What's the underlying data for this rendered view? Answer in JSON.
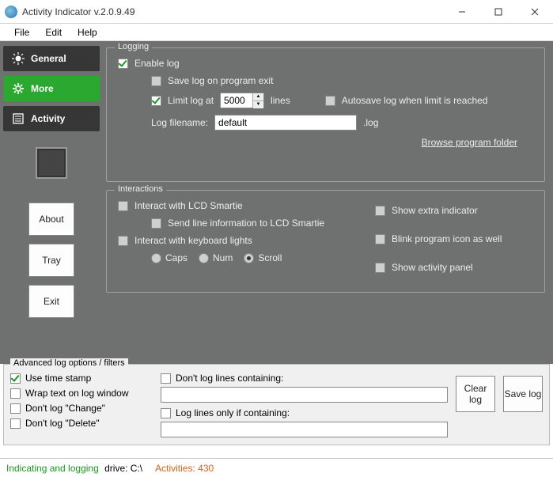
{
  "window": {
    "title": "Activity Indicator v.2.0.9.49"
  },
  "menu": {
    "file": "File",
    "edit": "Edit",
    "help": "Help"
  },
  "nav": {
    "general": "General",
    "more": "More",
    "activity": "Activity"
  },
  "sidebuttons": {
    "about": "About",
    "tray": "Tray",
    "exit": "Exit"
  },
  "logging": {
    "legend": "Logging",
    "enable": "Enable log",
    "save_on_exit": "Save log on program exit",
    "limit_at": "Limit log at",
    "limit_value": "5000",
    "lines": "lines",
    "autosave": "Autosave log when limit is reached",
    "filename_label": "Log filename:",
    "filename_value": "default",
    "ext": ".log",
    "browse": "Browse program folder"
  },
  "interactions": {
    "legend": "Interactions",
    "lcd": "Interact with LCD Smartie",
    "send_line": "Send line information to LCD Smartie",
    "kbd": "Interact with keyboard lights",
    "caps": "Caps",
    "num": "Num",
    "scroll": "Scroll",
    "extra": "Show extra indicator",
    "blink": "Blink program icon as well",
    "panel": "Show activity panel"
  },
  "advanced": {
    "legend": "Advanced log options / filters",
    "timestamp": "Use time stamp",
    "wrap": "Wrap text on log window",
    "no_change": "Don't log \"Change\"",
    "no_delete": "Don't log \"Delete\"",
    "dont_contain": "Don't log lines containing:",
    "only_contain": "Log lines only if containing:",
    "clear": "Clear log",
    "save": "Save log"
  },
  "status": {
    "indicating": "Indicating and logging",
    "drive_label": "drive:",
    "drive_value": "C:\\",
    "activities_label": "Activities:",
    "activities_value": "430"
  }
}
